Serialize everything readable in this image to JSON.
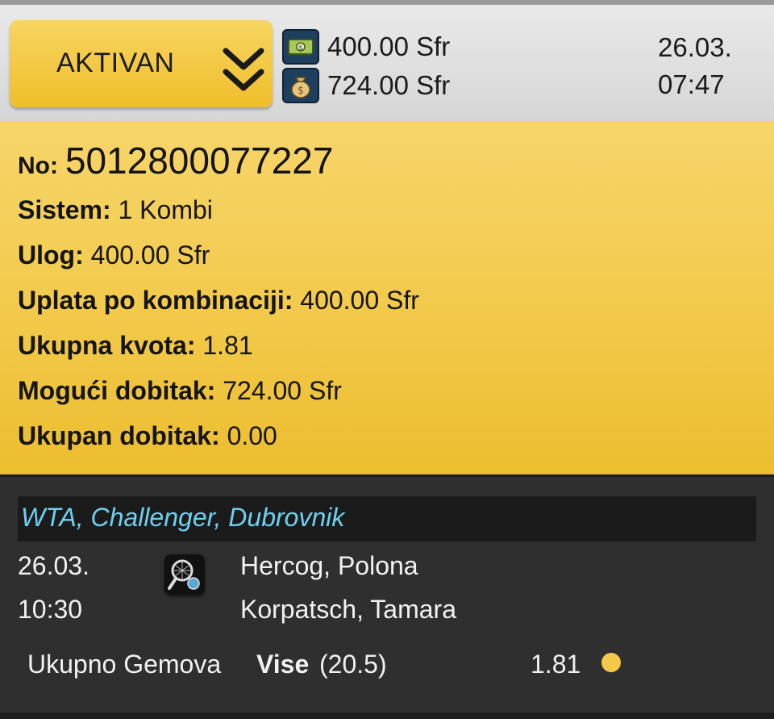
{
  "header": {
    "status_label": "AKTIVAN",
    "stake": "400.00 Sfr",
    "potential_win": "724.00 Sfr",
    "date": "26.03.",
    "time": "07:47"
  },
  "ticket": {
    "no_label": "No:",
    "no_value": "5012800077227",
    "rows": [
      {
        "label": "Sistem:",
        "value": "1 Kombi"
      },
      {
        "label": "Ulog:",
        "value": "400.00 Sfr"
      },
      {
        "label": "Uplata po kombinaciji:",
        "value": "400.00 Sfr"
      },
      {
        "label": "Ukupna kvota:",
        "value": "1.81"
      },
      {
        "label": "Mogući dobitak:",
        "value": "724.00 Sfr"
      },
      {
        "label": "Ukupan dobitak:",
        "value": "0.00"
      }
    ]
  },
  "match": {
    "league": "WTA, Challenger, Dubrovnik",
    "date": "26.03.",
    "time": "10:30",
    "player1": "Hercog, Polona",
    "player2": "Korpatsch, Tamara",
    "market": "Ukupno Gemova",
    "pick": "Vise",
    "line": "(20.5)",
    "odds": "1.81",
    "sport_icon": "tennis-racket-icon"
  },
  "colors": {
    "accent_yellow": "#f2c94a",
    "league_blue": "#6fd0ef",
    "dark_bg": "#2f2f2f"
  }
}
